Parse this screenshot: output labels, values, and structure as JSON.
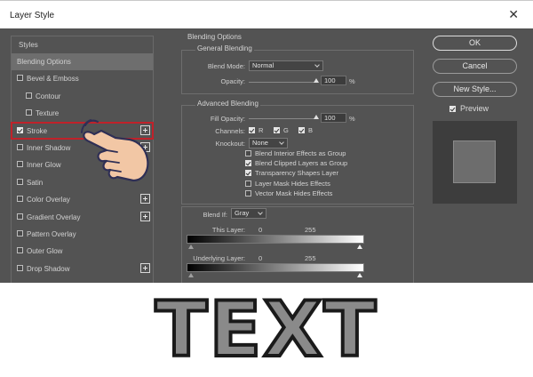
{
  "window": {
    "title": "Layer Style",
    "close_glyph": "✕"
  },
  "styles": {
    "header": "Styles",
    "items": [
      {
        "label": "Blending Options",
        "checkbox": false,
        "checked": false,
        "plus": false,
        "indent": 0,
        "active": true
      },
      {
        "label": "Bevel & Emboss",
        "checkbox": true,
        "checked": false,
        "plus": false,
        "indent": 0
      },
      {
        "label": "Contour",
        "checkbox": true,
        "checked": false,
        "plus": false,
        "indent": 1
      },
      {
        "label": "Texture",
        "checkbox": true,
        "checked": false,
        "plus": false,
        "indent": 1
      },
      {
        "label": "Stroke",
        "checkbox": true,
        "checked": true,
        "plus": true,
        "indent": 0
      },
      {
        "label": "Inner Shadow",
        "checkbox": true,
        "checked": false,
        "plus": true,
        "indent": 0
      },
      {
        "label": "Inner Glow",
        "checkbox": true,
        "checked": false,
        "plus": false,
        "indent": 0
      },
      {
        "label": "Satin",
        "checkbox": true,
        "checked": false,
        "plus": false,
        "indent": 0
      },
      {
        "label": "Color Overlay",
        "checkbox": true,
        "checked": false,
        "plus": true,
        "indent": 0
      },
      {
        "label": "Gradient Overlay",
        "checkbox": true,
        "checked": false,
        "plus": true,
        "indent": 0
      },
      {
        "label": "Pattern Overlay",
        "checkbox": true,
        "checked": false,
        "plus": false,
        "indent": 0
      },
      {
        "label": "Outer Glow",
        "checkbox": true,
        "checked": false,
        "plus": false,
        "indent": 0
      },
      {
        "label": "Drop Shadow",
        "checkbox": true,
        "checked": false,
        "plus": true,
        "indent": 0
      }
    ]
  },
  "blending": {
    "section_title": "Blending Options",
    "general": {
      "title": "General Blending",
      "blend_mode_label": "Blend Mode:",
      "blend_mode_value": "Normal",
      "opacity_label": "Opacity:",
      "opacity_value": "100",
      "opacity_unit": "%",
      "opacity_level": 1.0
    },
    "advanced": {
      "title": "Advanced Blending",
      "fill_opacity_label": "Fill Opacity:",
      "fill_opacity_value": "100",
      "fill_opacity_unit": "%",
      "fill_opacity_level": 1.0,
      "channels_label": "Channels:",
      "channels": [
        {
          "label": "R",
          "checked": true
        },
        {
          "label": "G",
          "checked": true
        },
        {
          "label": "B",
          "checked": true
        }
      ],
      "knockout_label": "Knockout:",
      "knockout_value": "None",
      "options": [
        {
          "label": "Blend Interior Effects as Group",
          "checked": false
        },
        {
          "label": "Blend Clipped Layers as Group",
          "checked": true
        },
        {
          "label": "Transparency Shapes Layer",
          "checked": true
        },
        {
          "label": "Layer Mask Hides Effects",
          "checked": false
        },
        {
          "label": "Vector Mask Hides Effects",
          "checked": false
        }
      ]
    },
    "blend_if": {
      "label": "Blend If:",
      "value": "Gray",
      "this_layer_label": "This Layer:",
      "this_layer_min": "0",
      "this_layer_max": "255",
      "underlying_label": "Underlying Layer:",
      "underlying_min": "0",
      "underlying_max": "255"
    }
  },
  "buttons": {
    "ok": "OK",
    "cancel": "Cancel",
    "new_style": "New Style..."
  },
  "preview": {
    "label": "Preview",
    "checked": true
  },
  "banner": {
    "text": "TEXT"
  },
  "colors": {
    "dialog_bg": "#535353",
    "highlight": "#c0222a",
    "hand_fill": "#f2c7a5",
    "hand_outline": "#2f2f55"
  },
  "icons": [
    "close-icon",
    "plus-icon",
    "pointing-hand-icon",
    "dropdown-chevron-icon"
  ]
}
